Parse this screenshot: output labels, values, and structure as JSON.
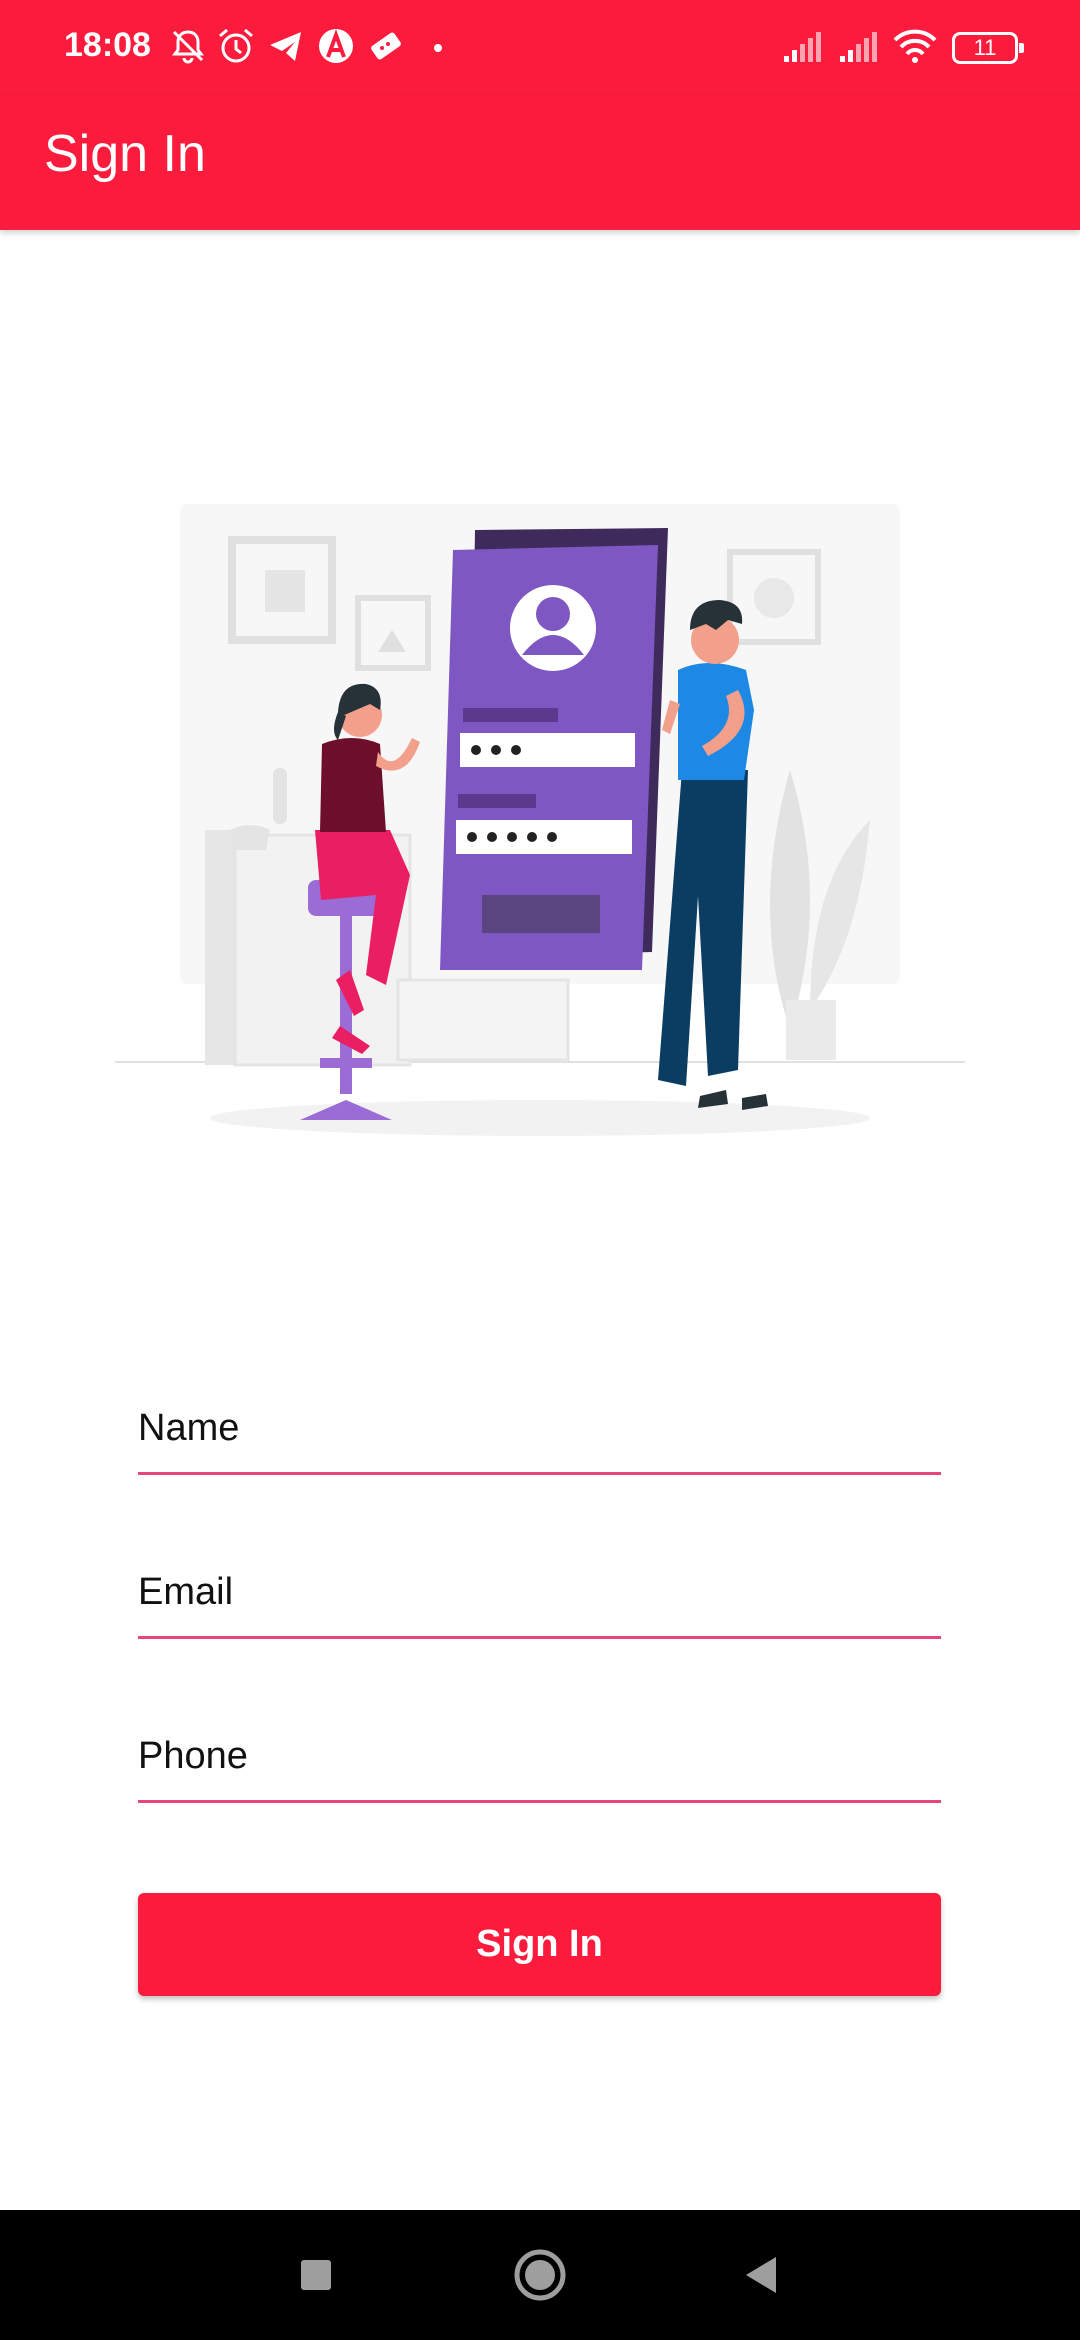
{
  "status_bar": {
    "time": "18:08",
    "battery": "11",
    "icons": [
      "bell-off-icon",
      "alarm-icon",
      "telegram-icon",
      "app-a-icon",
      "ticket-icon",
      "dot-icon",
      "signal-icon",
      "signal-icon",
      "wifi-icon",
      "battery-icon"
    ]
  },
  "app_bar": {
    "title": "Sign In"
  },
  "form": {
    "name_placeholder": "Name",
    "email_placeholder": "Email",
    "phone_placeholder": "Phone",
    "submit_label": "Sign In"
  },
  "nav_bar": {
    "buttons": [
      "recents-button",
      "home-button",
      "back-button"
    ]
  },
  "colors": {
    "accent": "#fb1c3d",
    "underline": "#e8457a",
    "illustration_purple": "#7e57c2"
  }
}
